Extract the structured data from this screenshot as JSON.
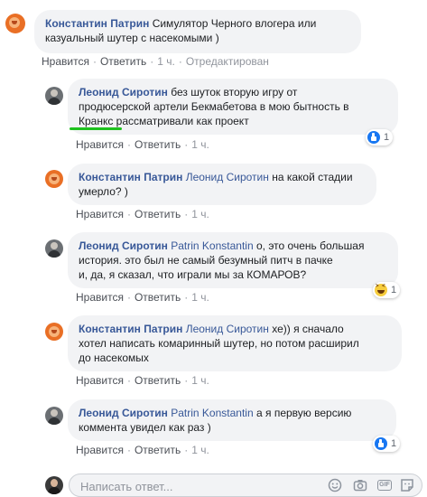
{
  "comments": [
    {
      "author": "Константин Патрин",
      "mention": "",
      "text_lines": [
        "Симулятор Черного влогера или",
        "казуальный шутер с насекомыми )"
      ],
      "like": "Нравится",
      "reply": "Ответить",
      "time": "1 ч.",
      "edited": "Отредактирован"
    },
    {
      "author": "Леонид Сиротин",
      "text_lines": [
        "без шуток вторую игру от",
        "продюсерской артели Бекмабетова в мою бытность в",
        "Кранкс рассматривали как проект"
      ],
      "like": "Нравится",
      "reply": "Ответить",
      "time": "1 ч.",
      "reaction_count": "1"
    },
    {
      "author": "Константин Патрин",
      "mention": "Леонид Сиротин",
      "text_lines": [
        "на какой стадии",
        "умерло? )"
      ],
      "like": "Нравится",
      "reply": "Ответить",
      "time": "1 ч."
    },
    {
      "author": "Леонид Сиротин",
      "mention": "Patrin Konstantin",
      "text_lines": [
        "о, это очень большая",
        "история. это был не самый безумный питч в пачке",
        "и, да, я сказал, что играли мы за КОМАРОВ?"
      ],
      "like": "Нравится",
      "reply": "Ответить",
      "time": "1 ч.",
      "reaction_count": "1"
    },
    {
      "author": "Константин Патрин",
      "mention": "Леонид Сиротин",
      "text_lines": [
        "хе)) я сначало",
        "хотел написать комаринный шутер, но потом расширил",
        "до насекомых"
      ],
      "like": "Нравится",
      "reply": "Ответить",
      "time": "1 ч."
    },
    {
      "author": "Леонид Сиротин",
      "mention": "Patrin Konstantin",
      "text_lines": [
        "а я первую версию",
        "коммента увидел как раз )"
      ],
      "like": "Нравится",
      "reply": "Ответить",
      "time": "1 ч.",
      "reaction_count": "1"
    }
  ],
  "composer": {
    "placeholder": "Написать ответ..."
  },
  "colors": {
    "link": "#385898",
    "bubble": "#f2f3f5",
    "underline": "#1ec21e",
    "like_blue": "#1877f2"
  }
}
